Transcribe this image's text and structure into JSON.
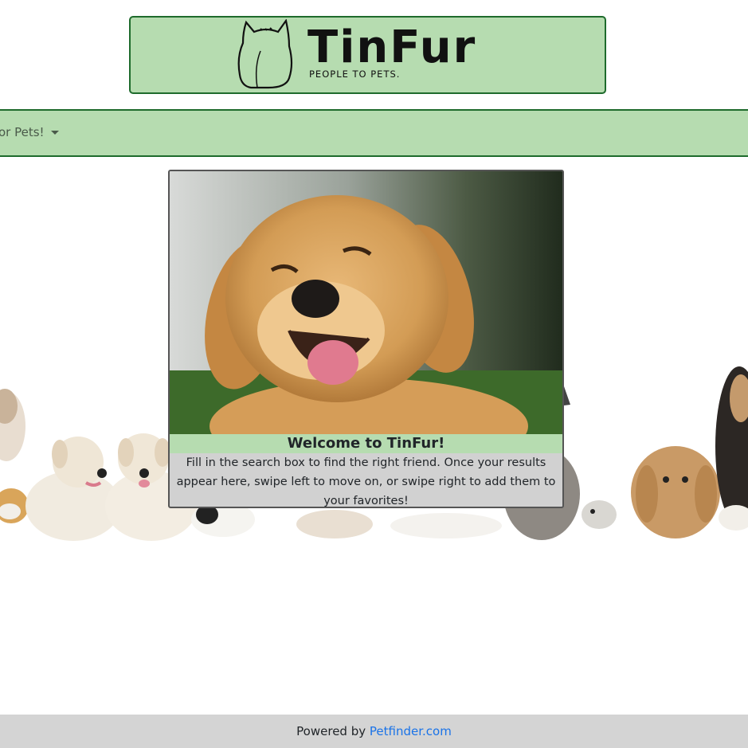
{
  "logo": {
    "title": "TinFur",
    "tagline": "PEOPLE TO PETS."
  },
  "nav": {
    "dropdown_label": "or Pets!"
  },
  "card": {
    "title": "Welcome to TinFur!",
    "text": "Fill in the search box to find the right friend. Once your results appear here, swipe left to move on, or swipe right to add them to your favorites!"
  },
  "footer": {
    "prefix": "Powered by ",
    "link_text": "Petfinder.com"
  },
  "colors": {
    "brand_green": "#b6dcb0",
    "border_green": "#1e6b2c",
    "link_blue": "#1a73e8",
    "footer_gray": "#d4d4d4"
  }
}
